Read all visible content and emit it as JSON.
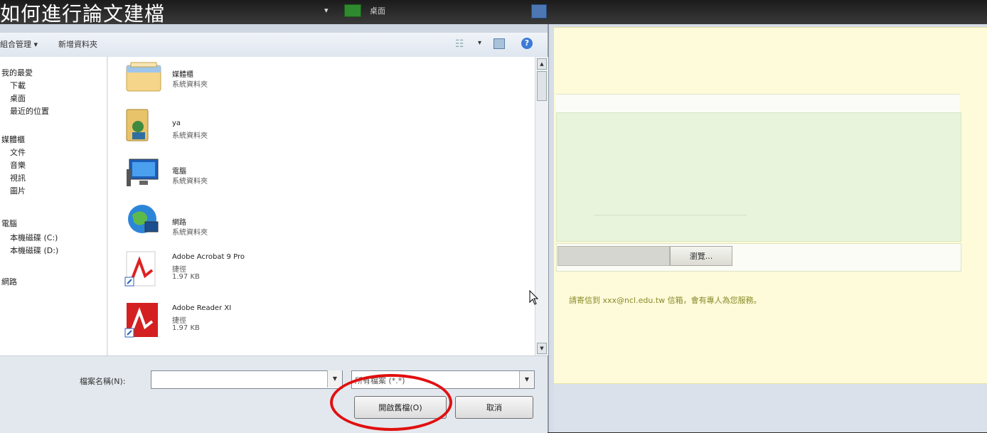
{
  "video": {
    "caption": "如何進行論文建檔"
  },
  "dialog": {
    "address_bar": {
      "dropdown_arrow": "▾",
      "location": "桌面"
    },
    "toolbar": {
      "organize": "組合管理 ▾",
      "new_folder": "新增資料夾",
      "view_dropdown": "▾",
      "help": "?"
    },
    "nav_items": [
      {
        "label": "我的最愛"
      },
      {
        "label": "下載"
      },
      {
        "label": "桌面"
      },
      {
        "label": "最近的位置"
      },
      {
        "label": "媒體櫃"
      },
      {
        "label": "文件"
      },
      {
        "label": "音樂"
      },
      {
        "label": "視訊"
      },
      {
        "label": "圖片"
      },
      {
        "label": "電腦"
      },
      {
        "label": "本機磁碟 (C:)"
      },
      {
        "label": "本機磁碟 (D:)"
      },
      {
        "label": "網路"
      }
    ],
    "files": [
      {
        "name": "媒體櫃",
        "type": "系統資料夾",
        "icon": "library-folder-icon"
      },
      {
        "name": "ya",
        "type": "系統資料夾",
        "icon": "user-folder-icon"
      },
      {
        "name": "電腦",
        "type": "系統資料夾",
        "icon": "computer-icon"
      },
      {
        "name": "網路",
        "type": "系統資料夾",
        "icon": "network-globe-icon"
      },
      {
        "name": "Adobe Acrobat 9 Pro",
        "type": "捷徑",
        "size": "1.97 KB",
        "icon": "acrobat-shortcut-icon"
      },
      {
        "name": "Adobe Reader XI",
        "type": "捷徑",
        "size": "1.97 KB",
        "icon": "reader-shortcut-icon"
      }
    ],
    "filename_label": "檔案名稱(N):",
    "filename_value": "",
    "filetype_value": "所有檔案 (*.*)",
    "open_button": "開啟舊檔(O)",
    "cancel_button": "取消"
  },
  "webpage": {
    "browse_button": "瀏覽...",
    "notice": "請寄信到 xxx@ncl.edu.tw 信箱，會有專人為您服務。"
  },
  "colors": {
    "highlight_circle": "#e01010",
    "dialog_bg": "#e9ecf0",
    "page_panel": "#fdfbd9",
    "green_box": "#e9f4dc"
  }
}
